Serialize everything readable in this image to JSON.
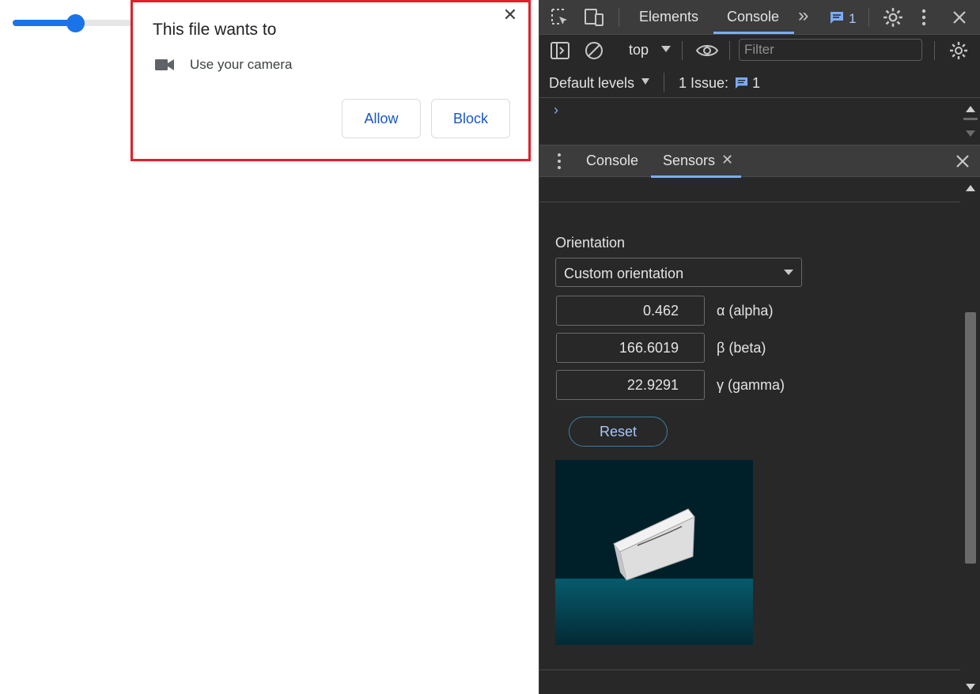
{
  "page": {
    "slider": {
      "value_fraction": 0.5
    }
  },
  "permission_prompt": {
    "title": "This file wants to",
    "permission_text": "Use your camera",
    "allow_label": "Allow",
    "block_label": "Block",
    "close_glyph": "✕",
    "camera_icon": "videocam-icon",
    "highlight_color": "#e0202c"
  },
  "devtools": {
    "top_tabs": {
      "elements": "Elements",
      "console": "Console",
      "more_glyph": "»",
      "issues_count": "1"
    },
    "toolbar": {
      "context": "top",
      "filter_placeholder": "Filter"
    },
    "levels": {
      "default_levels": "Default levels",
      "issues_label": "1 Issue:",
      "issues_count": "1"
    },
    "console_prompt": "›",
    "drawer": {
      "tabs": [
        {
          "label": "Console"
        },
        {
          "label": "Sensors"
        }
      ],
      "close_glyph": "✕"
    },
    "sensors": {
      "orientation_label": "Orientation",
      "orientation_selected": "Custom orientation",
      "alpha": {
        "value": "0.462",
        "label": "α (alpha)"
      },
      "beta": {
        "value": "166.6019",
        "label": "β (beta)"
      },
      "gamma": {
        "value": "22.9291",
        "label": "γ (gamma)"
      },
      "reset_label": "Reset"
    },
    "colors": {
      "accent": "#7cacf8",
      "background": "#282828"
    }
  }
}
